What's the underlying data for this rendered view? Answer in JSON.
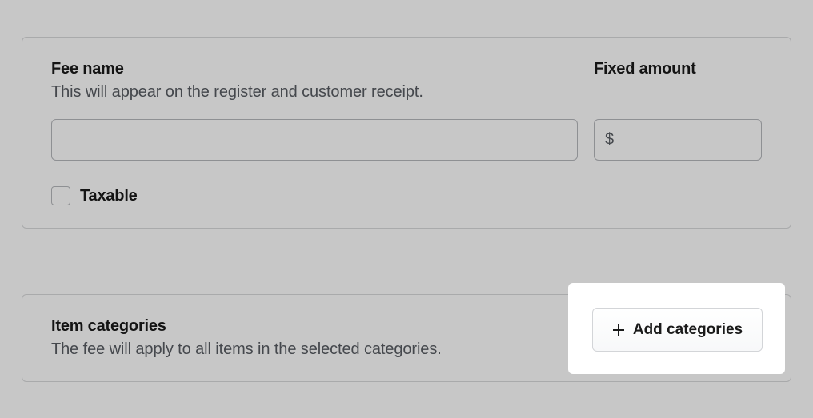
{
  "fee": {
    "name_label": "Fee name",
    "name_helper": "This will appear on the register and customer receipt.",
    "taxable_label": "Taxable"
  },
  "fixed": {
    "label": "Fixed amount",
    "currency_symbol": "$"
  },
  "categories": {
    "title": "Item categories",
    "helper": "The fee will apply to all items in the selected categories.",
    "add_label": "Add categories"
  }
}
